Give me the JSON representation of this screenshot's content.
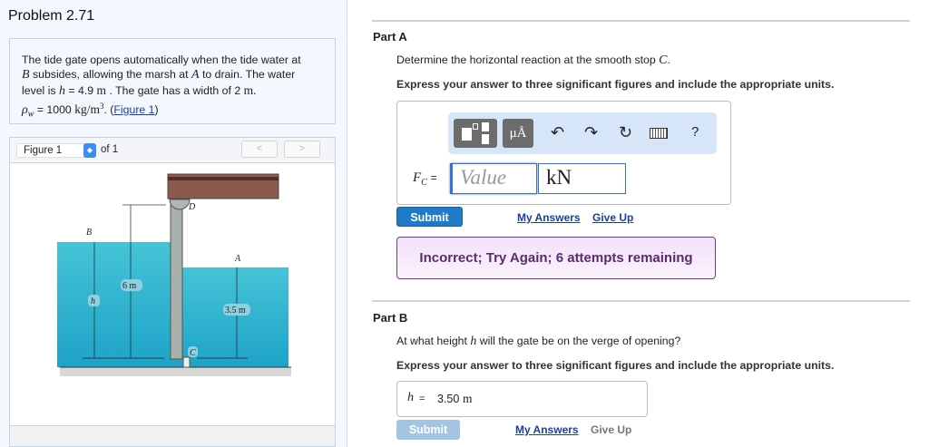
{
  "problem": {
    "title": "Problem 2.71",
    "text": {
      "l1": "The tide gate opens automatically when the tide water at",
      "B": "B",
      "l2a": " subsides, allowing the marsh at ",
      "A": "A",
      "l2b": " to drain. The water",
      "l3a": "level is ",
      "h": "h",
      "l3b": " = 4.9 ",
      "m": "m",
      "l3c": " . The gate has a width of 2 ",
      "m2": "m.",
      "rho": "ρ",
      "w": "w",
      "l4a": " = 1000 ",
      "units": "kg/m",
      "exp": "3",
      "l4b": ". (",
      "link": "Figure 1",
      "l4c": ")"
    }
  },
  "figure": {
    "selector": "Figure 1",
    "of": "of 1",
    "prev": "<",
    "next": ">",
    "labels": {
      "B": "B",
      "D": "D",
      "A": "A",
      "C": "C",
      "h": "h",
      "six": "6 m",
      "three": "3.5 m"
    }
  },
  "partA": {
    "heading": "Part A",
    "question_pre": "Determine the horizontal reaction at the smooth stop ",
    "question_var": "C",
    "question_post": ".",
    "instruction": "Express your answer to three significant figures and include the appropriate units.",
    "toolbar": {
      "units": "μÅ",
      "help": "?"
    },
    "label_main": "F",
    "label_sub": "C",
    "eq": "=",
    "value_placeholder": "Value",
    "unit_value": "kN",
    "submit": "Submit",
    "my_answers": "My Answers",
    "give_up": "Give Up",
    "feedback": "Incorrect; Try Again; 6 attempts remaining"
  },
  "partB": {
    "heading": "Part B",
    "question_pre": "At what height ",
    "question_var": "h",
    "question_post": " will the gate be on the verge of opening?",
    "instruction": "Express your answer to three significant figures and include the appropriate units.",
    "label": "h",
    "eq": "=",
    "answer": "3.50",
    "answer_unit": "m",
    "submit": "Submit",
    "my_answers": "My Answers",
    "give_up": "Give Up"
  }
}
